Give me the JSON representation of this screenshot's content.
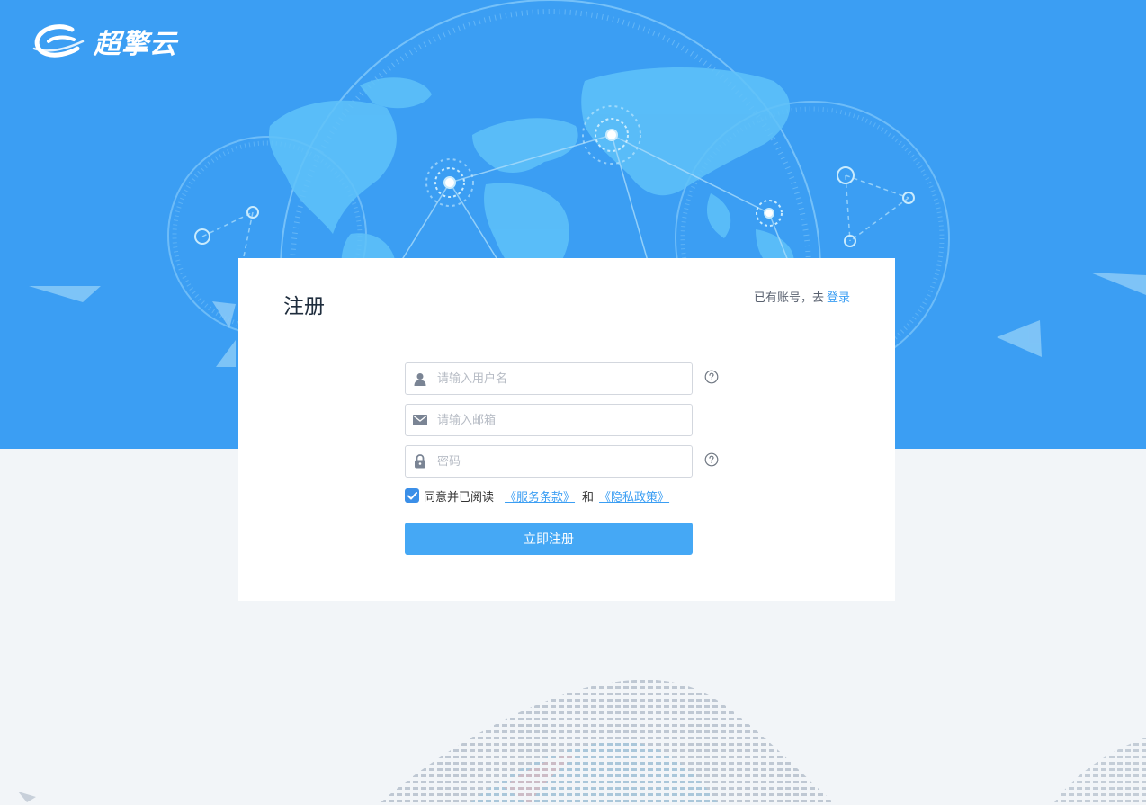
{
  "brand": {
    "name": "超擎云"
  },
  "card": {
    "title": "注册",
    "login_hint": "已有账号，去",
    "login_link": "登录"
  },
  "form": {
    "username_placeholder": "请输入用户名",
    "email_placeholder": "请输入邮箱",
    "password_placeholder": "密码",
    "agree_checked": true,
    "agree_text": "同意并已阅读",
    "terms_link": "《服务条款》",
    "and_text": "和",
    "privacy_link": "《隐私政策》",
    "submit_label": "立即注册"
  },
  "icons": {
    "username": "user-icon",
    "email": "envelope-icon",
    "password": "lock-icon",
    "help": "question-circle-icon",
    "checkbox": "checkmark-icon"
  },
  "colors": {
    "hero_bg": "#3b9ef3",
    "accent": "#3b9ef3",
    "button": "#45a8f5",
    "page_bg": "#f2f5f8"
  }
}
